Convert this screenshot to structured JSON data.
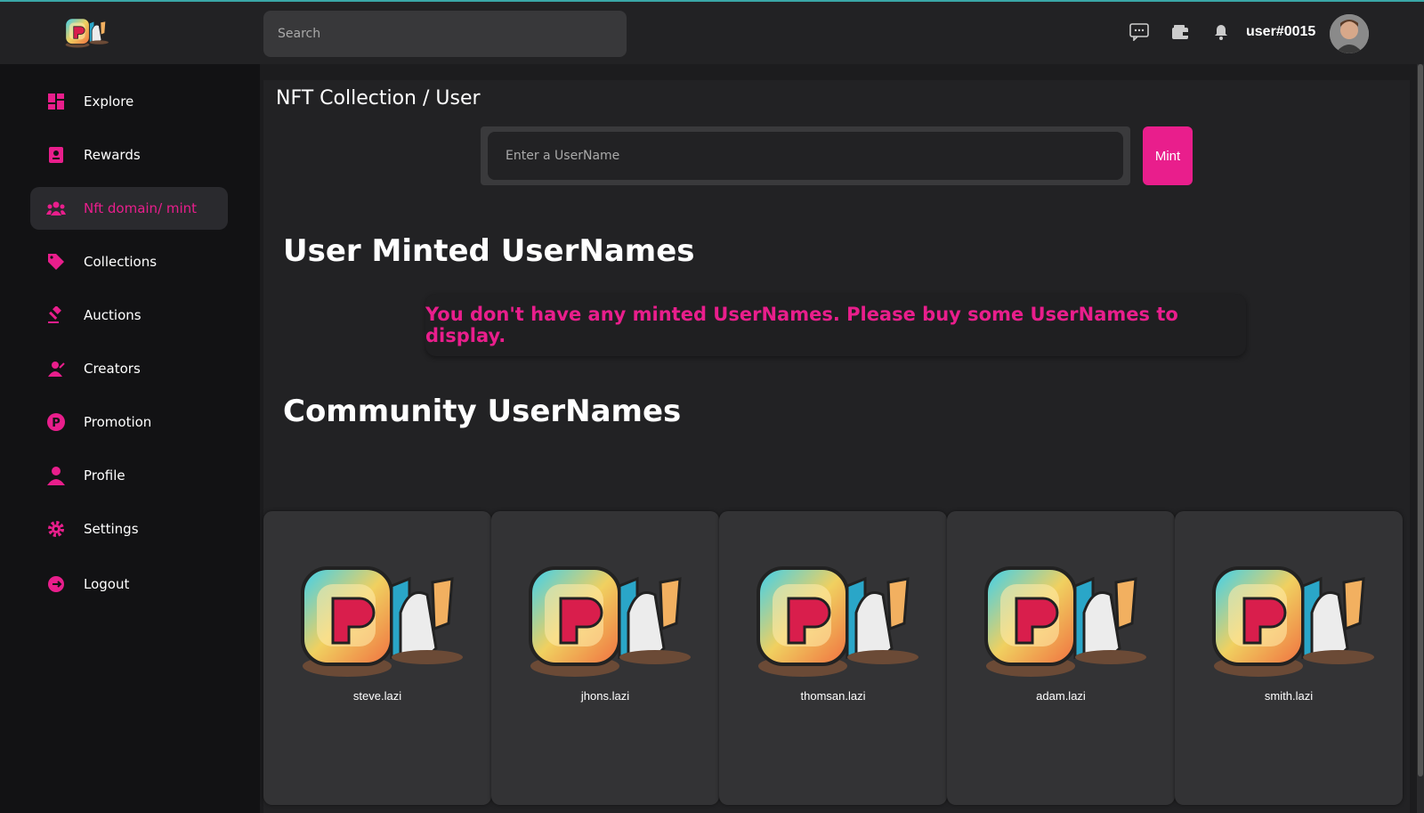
{
  "header": {
    "logo_alt": "Lazi logo",
    "search_placeholder": "Search",
    "username": "user#0015",
    "icons": [
      "chat-icon",
      "wallet-icon",
      "bell-icon"
    ]
  },
  "sidebar": {
    "items": [
      {
        "label": "Explore",
        "icon": "grid-icon"
      },
      {
        "label": "Rewards",
        "icon": "rewards-icon"
      },
      {
        "label": "Nft domain/ mint",
        "icon": "users-icon",
        "active": true
      },
      {
        "label": "Collections",
        "icon": "tag-icon"
      },
      {
        "label": "Auctions",
        "icon": "gavel-icon"
      },
      {
        "label": "Creators",
        "icon": "creator-icon"
      },
      {
        "label": "Promotion",
        "icon": "promotion-icon"
      },
      {
        "label": "Profile",
        "icon": "person-icon"
      },
      {
        "label": "Settings",
        "icon": "gear-icon"
      },
      {
        "label": "Logout",
        "icon": "logout-icon"
      }
    ]
  },
  "main": {
    "breadcrumb": "NFT Collection / User",
    "mint_placeholder": "Enter a UserName",
    "mint_button": "Mint",
    "user_minted_title": "User Minted UserNames",
    "notice": "You don't have any minted UserNames. Please buy some UserNames to display.",
    "community_title": "Community UserNames",
    "community": [
      {
        "name": "steve.lazi"
      },
      {
        "name": "jhons.lazi"
      },
      {
        "name": "thomsan.lazi"
      },
      {
        "name": "adam.lazi"
      },
      {
        "name": "smith.lazi"
      }
    ]
  },
  "colors": {
    "accent": "#e91e8c",
    "background": "#1c1c1e",
    "sidebar": "#121214",
    "panel": "#222224"
  }
}
